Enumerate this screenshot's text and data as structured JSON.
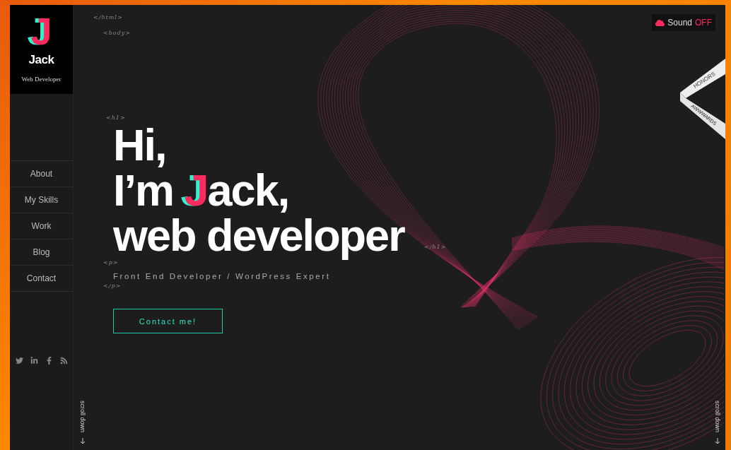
{
  "logo": {
    "letter": "J",
    "name": "Jack",
    "tagline": "Web Developer"
  },
  "nav": [
    {
      "label": "About"
    },
    {
      "label": "My Skills"
    },
    {
      "label": "Work"
    },
    {
      "label": "Blog"
    },
    {
      "label": "Contact"
    }
  ],
  "social": [
    {
      "kind": "twitter"
    },
    {
      "kind": "linkedin"
    },
    {
      "kind": "facebook"
    },
    {
      "kind": "rss"
    }
  ],
  "code_tags": {
    "html_close": "</html>",
    "body_open": "<body>",
    "h1_open": "<h1>",
    "h1_close": "</h1>",
    "p_open": "<p>",
    "p_close": "</p>"
  },
  "hero": {
    "line1": "Hi,",
    "line2_before": "I’m ",
    "accent": "J",
    "line2_after": "ack,",
    "line3": "web developer",
    "subtitle": "Front End Developer / WordPress Expert",
    "button": "Contact me!"
  },
  "sound": {
    "label": "Sound",
    "state": "OFF"
  },
  "ribbon": {
    "top": "HONORS",
    "bottom": "AWWWARDS"
  },
  "scroll_left": "scroll down",
  "scroll_right": "scroll down"
}
